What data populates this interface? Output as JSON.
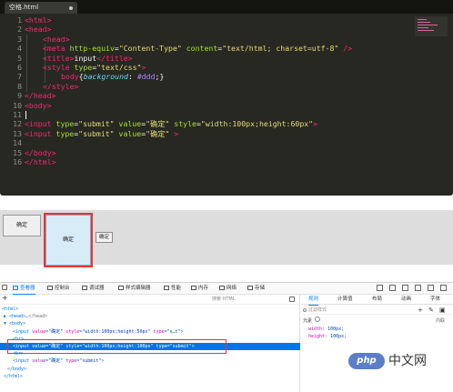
{
  "editor": {
    "tab_title": "空格.html",
    "line_numbers": [
      "1",
      "2",
      "3",
      "4",
      "5",
      "6",
      "7",
      "8",
      "9",
      "10",
      "11",
      "12",
      "13",
      "14",
      "15",
      "16"
    ]
  },
  "code": {
    "l1_tag": "<html>",
    "l2_tag": "<head>",
    "l3_tag": "<head>",
    "l4_open": "<meta ",
    "l4_attr1": "http-equiv",
    "l4_eq1": "=",
    "l4_val1": "\"Content-Type\"",
    "l4_attr2": " content",
    "l4_eq2": "=",
    "l4_val2": "\"text/html; charset=utf-8\"",
    "l4_close": " />",
    "l5_open": "<title>",
    "l5_text": "input",
    "l5_close": "</title>",
    "l6_open": "<style ",
    "l6_attr": "type",
    "l6_eq": "=",
    "l6_val": "\"text/css\"",
    "l6_close": ">",
    "l7_sel": "body",
    "l7_brace_open": "{",
    "l7_prop": "background",
    "l7_colon": ": ",
    "l7_val": "#ddd",
    "l7_end": ";}",
    "l8_tag": "</style>",
    "l9_tag": "</head>",
    "l10_tag": "<body>",
    "l12_open": "<input ",
    "l12_a1": "type",
    "l12_v1": "\"submit\"",
    "l12_a2": " value",
    "l12_v2": "\"确定\"",
    "l12_a3": " style",
    "l12_v3": "\"width:100px;height:60px\"",
    "l12_close": ">",
    "l13_open": "<input ",
    "l13_a1": "type",
    "l13_v1": "\"submit\"",
    "l13_a2": " value",
    "l13_v2": "\"确定\"",
    "l13_close": " >",
    "l15_tag": "</body>",
    "l16_tag": "</html>",
    "eq": "="
  },
  "rendered": {
    "button1": "确定",
    "button2": "确定",
    "button3": "确定"
  },
  "devtools": {
    "tabs": [
      "查看器",
      "控制台",
      "调试器",
      "样式编辑器",
      "性能",
      "内存",
      "网络",
      "存储"
    ],
    "search_placeholder": "搜索 HTML",
    "dom_lines": [
      {
        "t": "<html>"
      },
      {
        "t": "▶ <head>",
        "p": "…</head>"
      },
      {
        "t": "▼ <body>"
      },
      {
        "t": "<input ",
        "a1": "value",
        "v1": "\"确定\"",
        "a2": " style",
        "v2": "\"width:100px;height:50px\"",
        "a3": " type",
        "v3": "\"s…t\"",
        "end": ">"
      },
      {
        "t": "<br>"
      },
      {
        "t": "<input ",
        "a1": "value",
        "v1": "\"确定\"",
        "a2": " style",
        "v2": "\"width:100px;height:100px\"",
        "a3": " type",
        "v3": "\"submit\"",
        "end": ">"
      },
      {
        "t": "<br>"
      },
      {
        "t": "<input ",
        "a1": "value",
        "v1": "\"确定\"",
        "a2": " type",
        "v2": "\"submit\"",
        "end": ">"
      },
      {
        "t": "</body>"
      },
      {
        "t": "</html>"
      }
    ],
    "right_tabs": [
      "规则",
      "计算值",
      "布局",
      "动画",
      "字体"
    ],
    "filter_placeholder": "过滤样式",
    "rule_selector": "元素",
    "rule_source": "内联",
    "rule_decls": [
      {
        "k": "width",
        "n": "100px"
      },
      {
        "k": "height",
        "n": "100px"
      }
    ]
  },
  "watermark": {
    "badge": "php",
    "text": "中文网"
  }
}
